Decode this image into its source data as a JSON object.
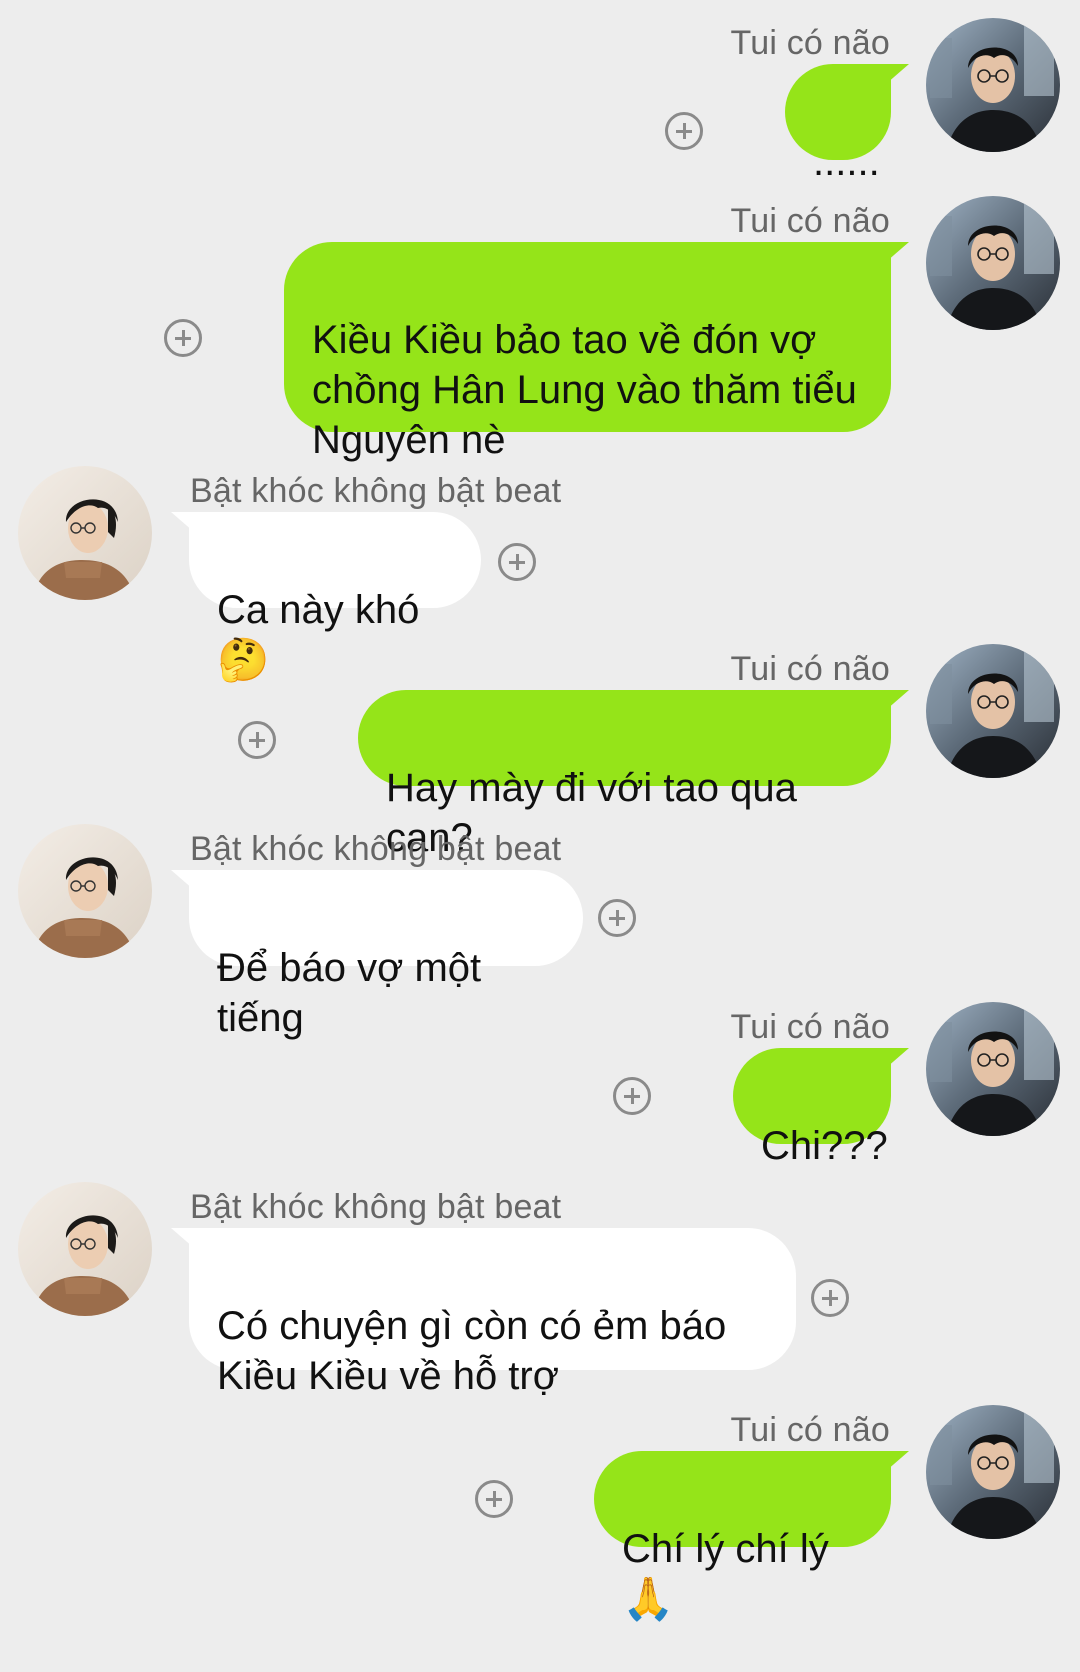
{
  "chat": {
    "me_name": "Tui có não",
    "them_name": "Bật khóc không bật beat",
    "colors": {
      "background": "#ededed",
      "outgoing_bubble": "#95e419",
      "incoming_bubble": "#ffffff",
      "sender_text": "#666666"
    },
    "messages": [
      {
        "from": "me",
        "sender": "Tui có não",
        "text": "......"
      },
      {
        "from": "me",
        "sender": "Tui có não",
        "text": "Kiều Kiều bảo tao về đón vợ\nchồng Hân Lung vào thăm tiểu\nNguyên nè"
      },
      {
        "from": "them",
        "sender": "Bật khóc không bật beat",
        "text": "Ca này khó",
        "emoji": "🤔"
      },
      {
        "from": "me",
        "sender": "Tui có não",
        "text": "Hay mày đi với tao qua can?"
      },
      {
        "from": "them",
        "sender": "Bật khóc không bật beat",
        "text": "Để báo vợ một tiếng"
      },
      {
        "from": "me",
        "sender": "Tui có não",
        "text": "Chi???"
      },
      {
        "from": "them",
        "sender": "Bật khóc không bật beat",
        "text": "Có chuyện gì còn có ẻm báo\nKiều Kiều về hỗ trợ"
      },
      {
        "from": "me",
        "sender": "Tui có não",
        "text": "Chí lý chí lý",
        "emoji": "🙏"
      }
    ]
  }
}
